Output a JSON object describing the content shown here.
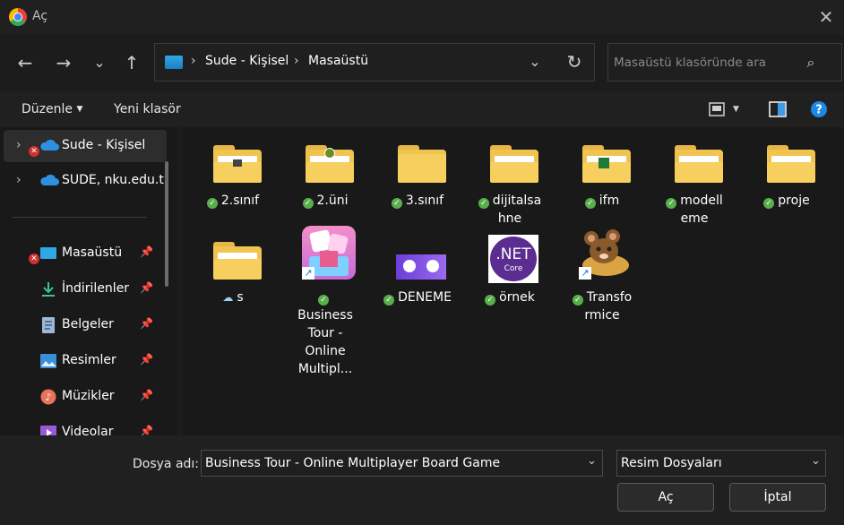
{
  "window": {
    "title": "Aç"
  },
  "address": {
    "crumbs": [
      "Sude - Kişisel",
      "Masaüstü"
    ]
  },
  "search": {
    "placeholder": "Masaüstü klasöründe ara"
  },
  "toolbar": {
    "organize": "Düzenle",
    "new_folder": "Yeni klasör"
  },
  "sidebar": {
    "tree": [
      {
        "label": "Sude - Kişisel",
        "icon": "onedrive-cloud-icon",
        "error": true,
        "selected": true
      },
      {
        "label": "SUDE, nku.edu.tı",
        "icon": "onedrive-cloud-icon"
      }
    ],
    "quick": [
      {
        "label": "Masaüstü",
        "icon": "desktop-icon",
        "error": true
      },
      {
        "label": "İndirilenler",
        "icon": "download-icon"
      },
      {
        "label": "Belgeler",
        "icon": "documents-icon"
      },
      {
        "label": "Resimler",
        "icon": "pictures-icon"
      },
      {
        "label": "Müzikler",
        "icon": "music-icon"
      },
      {
        "label": "Videolar",
        "icon": "videos-icon"
      }
    ]
  },
  "files": [
    {
      "name": "2.sınıf",
      "type": "folder",
      "status": "synced"
    },
    {
      "name": "2.üni",
      "type": "folder",
      "status": "synced"
    },
    {
      "name": "3.sınıf",
      "type": "folder",
      "status": "synced"
    },
    {
      "name": "dijitalsahne",
      "type": "folder",
      "status": "synced"
    },
    {
      "name": "ifm",
      "type": "folder",
      "status": "synced"
    },
    {
      "name": "modelleme",
      "type": "folder",
      "status": "synced"
    },
    {
      "name": "proje",
      "type": "folder",
      "status": "synced"
    },
    {
      "name": "s",
      "type": "folder",
      "status": "cloud"
    },
    {
      "name": "Business Tour - Online Multipl...",
      "type": "shortcut",
      "status": "synced"
    },
    {
      "name": "DENEME",
      "type": "image",
      "status": "synced"
    },
    {
      "name": "örnek",
      "type": "image",
      "status": "synced"
    },
    {
      "name": "Transformice",
      "type": "shortcut",
      "status": "synced"
    }
  ],
  "footer": {
    "filename_label": "Dosya adı:",
    "filename_value": "Business Tour - Online Multiplayer Board Game",
    "filetype": "Resim Dosyaları",
    "open": "Aç",
    "cancel": "İptal"
  },
  "net_thumb": {
    "line1": ".NET",
    "line2": "Core"
  }
}
